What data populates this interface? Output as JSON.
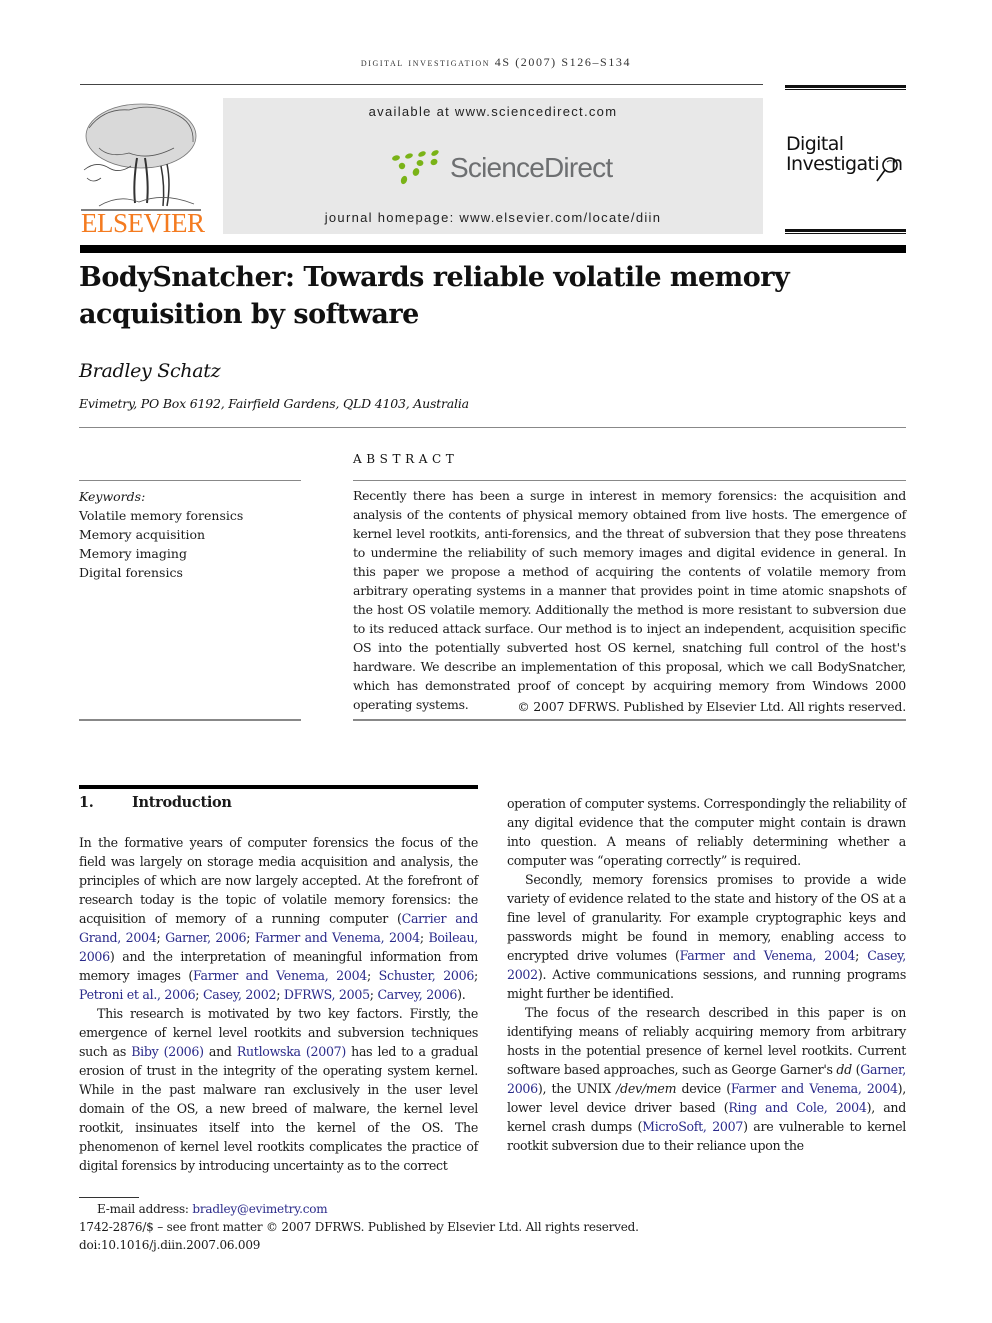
{
  "running_head": "digital investigation 4S (2007) S126–S134",
  "header": {
    "publisher_logo": "ELSEVIER",
    "available_at": "available at www.sciencedirect.com",
    "sciencedirect_logo": "ScienceDirect",
    "journal_homepage": "journal homepage: www.elsevier.com/locate/diin",
    "journal_logo_line1": "Digital",
    "journal_logo_line2": "Investigati",
    "journal_logo_line2_end": "n",
    "icons": {
      "publisher": "elsevier-tree-icon",
      "sciencedirect": "sciencedirect-dots-icon",
      "journal": "magnifying-glass-icon"
    },
    "colors": {
      "elsevier_orange": "#f47b20",
      "sciencedirect_green": "#7ab317",
      "sciencedirect_gray": "#6d6f71",
      "banner_bg": "#e8e8e8",
      "citation_link": "#2a2a8a"
    }
  },
  "article": {
    "title": "BodySnatcher: Towards reliable volatile memory acquisition by software",
    "author": "Bradley Schatz",
    "affiliation": "Evimetry, PO Box 6192, Fairfield Gardens, QLD 4103, Australia"
  },
  "keywords": {
    "label": "Keywords:",
    "items": [
      "Volatile memory forensics",
      "Memory acquisition",
      "Memory imaging",
      "Digital forensics"
    ]
  },
  "abstract": {
    "heading": "ABSTRACT",
    "text": "Recently there has been a surge in interest in memory forensics: the acquisition and analysis of the contents of physical memory obtained from live hosts. The emergence of kernel level rootkits, anti-forensics, and the threat of subversion that they pose threatens to undermine the reliability of such memory images and digital evidence in general. In this paper we propose a method of acquiring the contents of volatile memory from arbitrary operating systems in a manner that provides point in time atomic snapshots of the host OS volatile memory. Additionally the method is more resistant to subversion due to its reduced attack surface. Our method is to inject an independent, acquisition specific OS into the potentially subverted host OS kernel, snatching full control of the host's hardware. We describe an implementation of this proposal, which we call BodySnatcher, which has demonstrated proof of concept by acquiring memory from Windows 2000 operating systems.",
    "copyright": "© 2007 DFRWS. Published by Elsevier Ltd. All rights reserved."
  },
  "section": {
    "number": "1.",
    "title": "Introduction"
  },
  "body": {
    "p1": {
      "t0": "In the formative years of computer forensics the focus of the field was largely on storage media acquisition and analysis, the principles of which are now largely accepted. At the forefront of research today is the topic of volatile memory forensics: the acquisition of memory of a running computer (",
      "c0": "Carrier and Grand, 2004",
      "t1": "; ",
      "c1": "Garner, 2006",
      "t2": "; ",
      "c2": "Farmer and Venema, 2004",
      "t3": "; ",
      "c3": "Boileau, 2006",
      "t4": ") and the interpretation of meaningful information from memory images (",
      "c4": "Farmer and Venema, 2004",
      "t5": "; ",
      "c5": "Schuster, 2006",
      "t6": "; ",
      "c6": "Petroni et al., 2006",
      "t7": "; ",
      "c7": "Casey, 2002",
      "t8": "; ",
      "c8": "DFRWS, 2005",
      "t9": "; ",
      "c9": "Carvey, 2006",
      "t10": ")."
    },
    "p2": {
      "t0": "This research is motivated by two key factors. Firstly, the emergence of kernel level rootkits and subversion techniques such as ",
      "c0": "Biby (2006)",
      "t1": " and ",
      "c1": "Rutlowska (2007)",
      "t2": " has led to a gradual erosion of trust in the integrity of the operating system kernel. While in the past malware ran exclusively in the user level domain of the OS, a new breed of malware, the kernel level rootkit, insinuates itself into the kernel of the OS. The phenomenon of kernel level rootkits complicates the practice of digital forensics by introducing uncertainty as to the correct operation of computer systems. Correspondingly the reliability of any digital evidence that the computer might contain is drawn into question. A means of reliably determining whether a computer was “operating correctly” is required."
    },
    "p3": {
      "t0": "Secondly, memory forensics promises to provide a wide variety of evidence related to the state and history of the OS at a fine level of granularity. For example cryptographic keys and passwords might be found in memory, enabling access to encrypted drive volumes (",
      "c0": "Farmer and Venema, 2004",
      "t1": "; ",
      "c1": "Casey, 2002",
      "t2": "). Active communications sessions, and running programs might further be identified."
    },
    "p4": {
      "t0": "The focus of the research described in this paper is on identifying means of reliably acquiring memory from arbitrary hosts in the potential presence of kernel level rootkits. Current software based approaches, such as George Garner's ",
      "i0": "dd",
      "t1": " (",
      "c0": "Garner, 2006",
      "t2": "), the UNIX ",
      "i1": "/dev/mem",
      "t3": " device (",
      "c1": "Farmer and Venema, 2004",
      "t4": "), lower level device driver based (",
      "c2": "Ring and Cole, 2004",
      "t5": "), and kernel crash dumps (",
      "c3": "MicroSoft, 2007",
      "t6": ") are vulnerable to kernel rootkit subversion due to their reliance upon the"
    }
  },
  "footnote": {
    "email_label": "E-mail address: ",
    "email": "bradley@evimetry.com",
    "front_matter": "1742-2876/$ – see front matter © 2007 DFRWS. Published by Elsevier Ltd. All rights reserved.",
    "doi": "doi:10.1016/j.diin.2007.06.009"
  }
}
